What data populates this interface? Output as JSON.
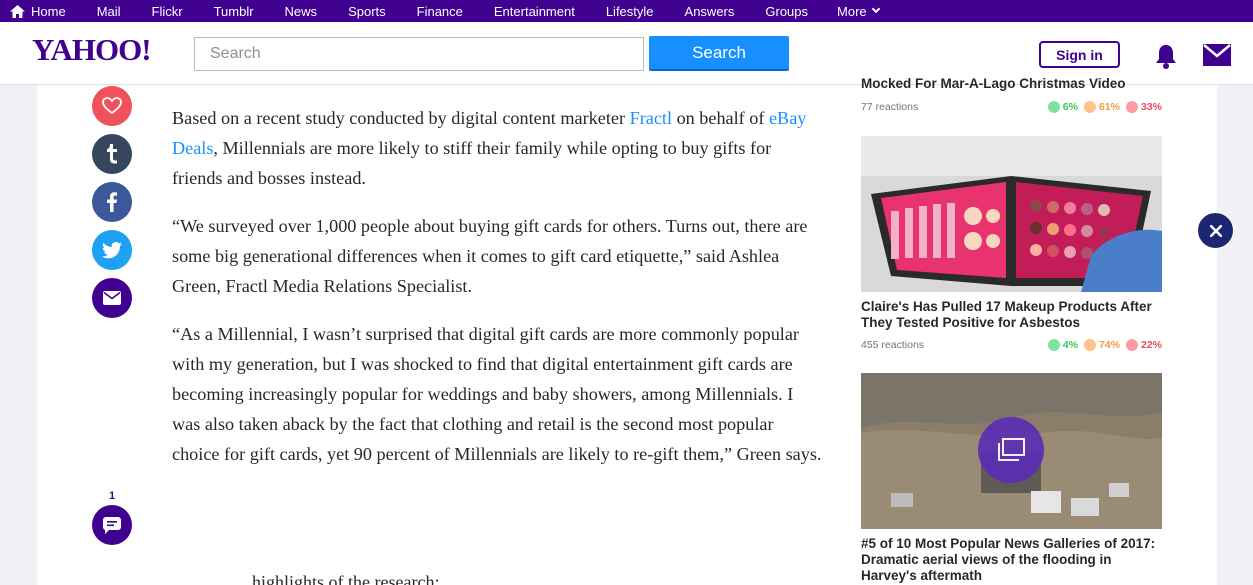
{
  "nav": {
    "items": [
      "Home",
      "Mail",
      "Flickr",
      "Tumblr",
      "News",
      "Sports",
      "Finance",
      "Entertainment",
      "Lifestyle",
      "Answers",
      "Groups",
      "More"
    ]
  },
  "header": {
    "logo": "YAHOO!",
    "search_placeholder": "Search",
    "search_button": "Search",
    "signin_label": "Sign in"
  },
  "share": {
    "comment_count": "1"
  },
  "article": {
    "p1_before": "Based on a recent study conducted by digital content marketer ",
    "p1_link1": "Fractl",
    "p1_mid": " on behalf of ",
    "p1_link2": "eBay Deals",
    "p1_after": ", Millennials are more likely to stiff their family while opting to buy gifts for friends and bosses instead.",
    "p2": "“We surveyed over 1,000 people about buying gift cards for others. Turns out, there are some big generational differences when it comes to gift card etiquette,” said Ashlea Green, Fractl Media Relations Specialist.",
    "p3": "“As a Millennial, I wasn’t surprised that digital gift cards are more commonly popular with my generation, but I was shocked to find that digital entertainment gift cards are becoming increasingly popular for weddings and baby showers, among Millennials. I was also taken aback by the fact that clothing and retail is the second most popular choice for gift cards, yet 90 percent of Millennials are likely to re-gift them,” Green says.",
    "cut_line": "highlights of the research:"
  },
  "rail": [
    {
      "headline": "Mocked For Mar-A-Lago Christmas Video",
      "reactions": "77 reactions",
      "happy": "6%",
      "neutral": "61%",
      "sad": "33%"
    },
    {
      "headline": "Claire's Has Pulled 17 Makeup Products After They Tested Positive for Asbestos",
      "reactions": "455 reactions",
      "happy": "4%",
      "neutral": "74%",
      "sad": "22%"
    },
    {
      "headline": "#5 of 10 Most Popular News Galleries of 2017: Dramatic aerial views of the flooding in Harvey's aftermath"
    }
  ],
  "colors": {
    "brand": "#400090",
    "search_blue": "#188fff",
    "link": "#188fff",
    "heart": "#f0515c"
  }
}
